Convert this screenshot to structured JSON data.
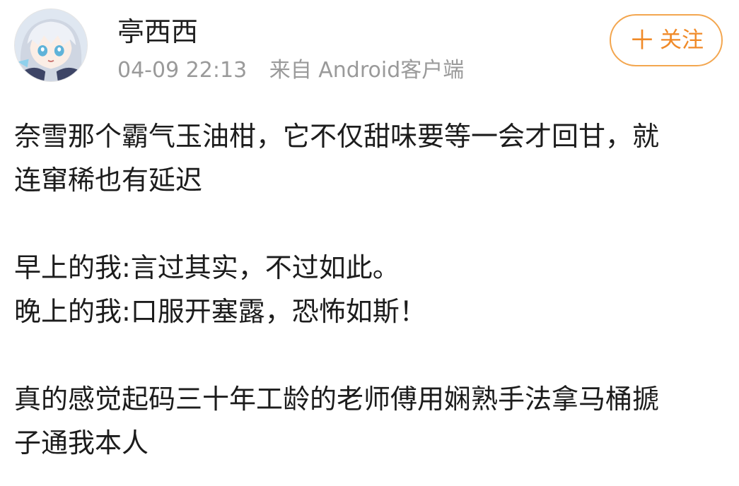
{
  "post": {
    "author": {
      "name": "亭西西"
    },
    "meta": {
      "time": "04-09 22:13",
      "source": "来自 Android客户端"
    },
    "follow": {
      "plus": "＋",
      "label": "关注",
      "accent_color": "#f08a28"
    },
    "body": {
      "paragraph1": {
        "line1": "奈雪那个霸气玉油柑，它不仅甜味要等一会才回甘，就",
        "line2": "连窜稀也有延迟"
      },
      "paragraph2": {
        "line1": "早上的我:言过其实，不过如此。",
        "line2": "晚上的我:口服开塞露，恐怖如斯！"
      },
      "paragraph3": {
        "line1": "真的感觉起码三十年工龄的老师傅用娴熟手法拿马桶搋",
        "line2": "子通我本人"
      }
    }
  }
}
